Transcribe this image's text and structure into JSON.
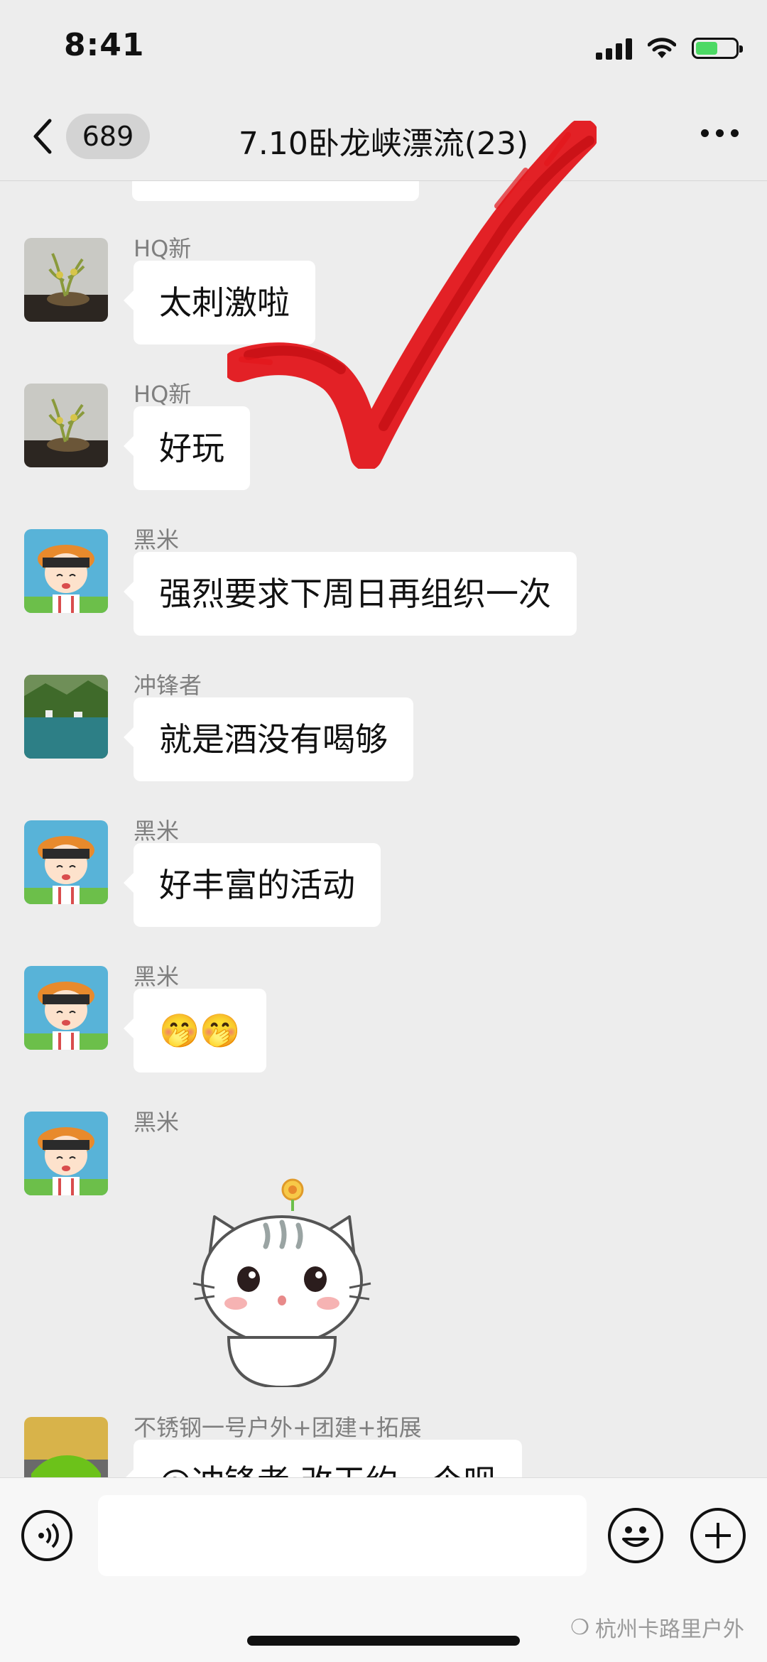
{
  "status_bar": {
    "time": "8:41",
    "battery_level": 0.55
  },
  "nav": {
    "unread_count": "689",
    "title": "7.10卧龙峡漂流(23)"
  },
  "messages": [
    {
      "sender": "HQ新",
      "text": "太刺激啦",
      "avatar": "plant-photo"
    },
    {
      "sender": "HQ新",
      "text": "好玩",
      "avatar": "plant-photo"
    },
    {
      "sender": "黑米",
      "text": "强烈要求下周日再组织一次",
      "avatar": "cartoon-girl"
    },
    {
      "sender": "冲锋者",
      "text": "就是酒没有喝够",
      "avatar": "lake-landscape"
    },
    {
      "sender": "黑米",
      "text": "好丰富的活动",
      "avatar": "cartoon-girl"
    },
    {
      "sender": "黑米",
      "text": "🤭🤭",
      "avatar": "cartoon-girl"
    },
    {
      "sender": "黑米",
      "text": "",
      "avatar": "cartoon-girl",
      "content": "cat-sticker"
    },
    {
      "sender": "不锈钢一号户外+团建+拓展",
      "text": "@冲锋者 改天约一个呗",
      "avatar": "green-sports-car"
    }
  ],
  "watermark": "杭州卡路里户外",
  "colors": {
    "background": "#ededed",
    "bubble": "#ffffff",
    "overlay_check": "#e3161b",
    "battery": "#4cd964"
  }
}
